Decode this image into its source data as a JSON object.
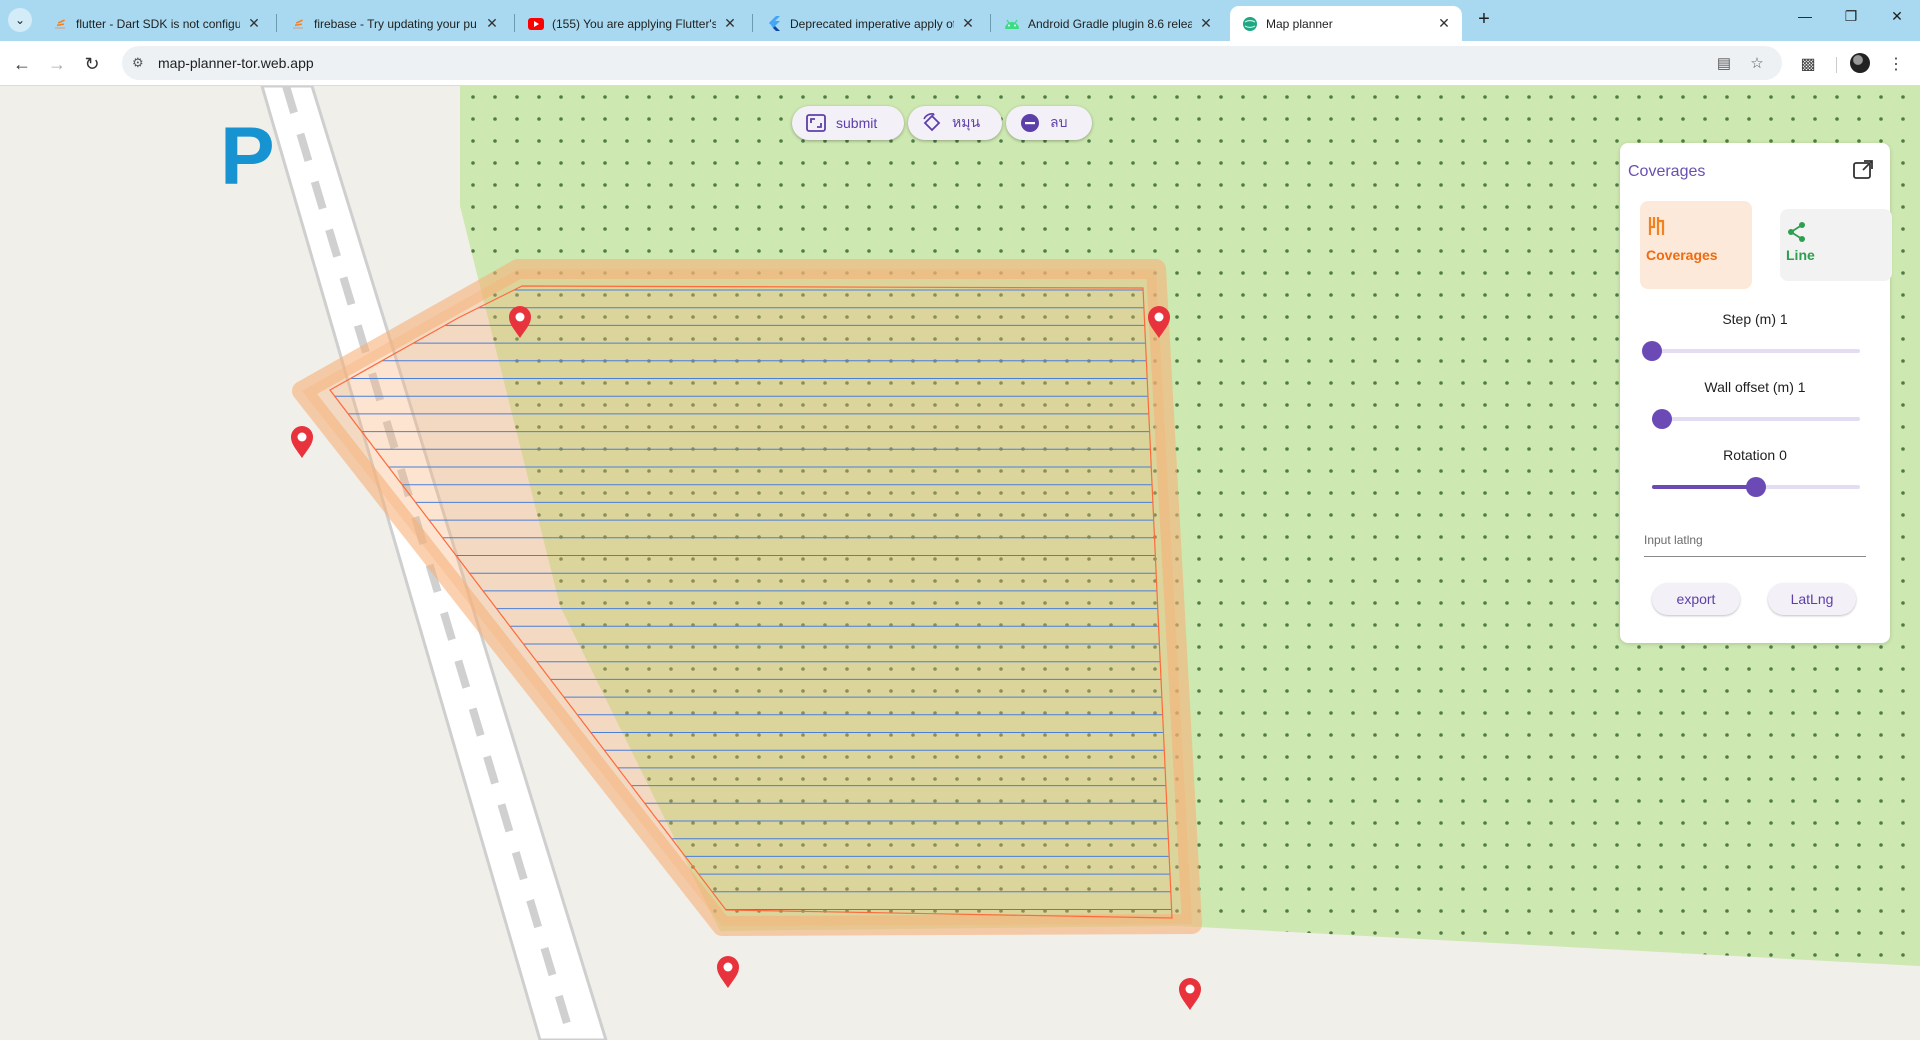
{
  "browser": {
    "tabs": [
      {
        "title": "flutter - Dart SDK is not configu",
        "icon": "stackoverflow-icon"
      },
      {
        "title": "firebase - Try updating your pu",
        "icon": "stackoverflow-icon"
      },
      {
        "title": "(155) You are applying Flutter's",
        "icon": "youtube-icon"
      },
      {
        "title": "Deprecated imperative apply of",
        "icon": "flutter-icon"
      },
      {
        "title": "Android Gradle plugin 8.6 relea",
        "icon": "android-icon"
      },
      {
        "title": "Map planner",
        "icon": "globe-icon"
      }
    ],
    "url": "map-planner-tor.web.app"
  },
  "map": {
    "parking_label": "P",
    "colors": {
      "park": "#cde8b0",
      "ground": "#f1efe9",
      "polygon": "#f6b179",
      "grid_line": "#4a7fd8",
      "marker": "#e8323c"
    }
  },
  "controls": {
    "submit_label": "submit",
    "rotate_label": "หมุน",
    "delete_label": "ลบ"
  },
  "panel": {
    "title": "Coverages",
    "modes": [
      {
        "label": "Coverages",
        "icon": "coverage-icon",
        "active": true
      },
      {
        "label": "Line",
        "icon": "share-icon",
        "active": false
      }
    ],
    "sliders": [
      {
        "label": "Step (m)  1",
        "value": 1,
        "min": 1,
        "max": 50
      },
      {
        "label": "Wall offset (m)  1",
        "value": 1,
        "min": 0,
        "max": 20
      },
      {
        "label": "Rotation 0",
        "value": 0,
        "min": -180,
        "max": 180
      }
    ],
    "input_placeholder": "Input latlng",
    "export_label": "export",
    "latlng_label": "LatLng"
  }
}
